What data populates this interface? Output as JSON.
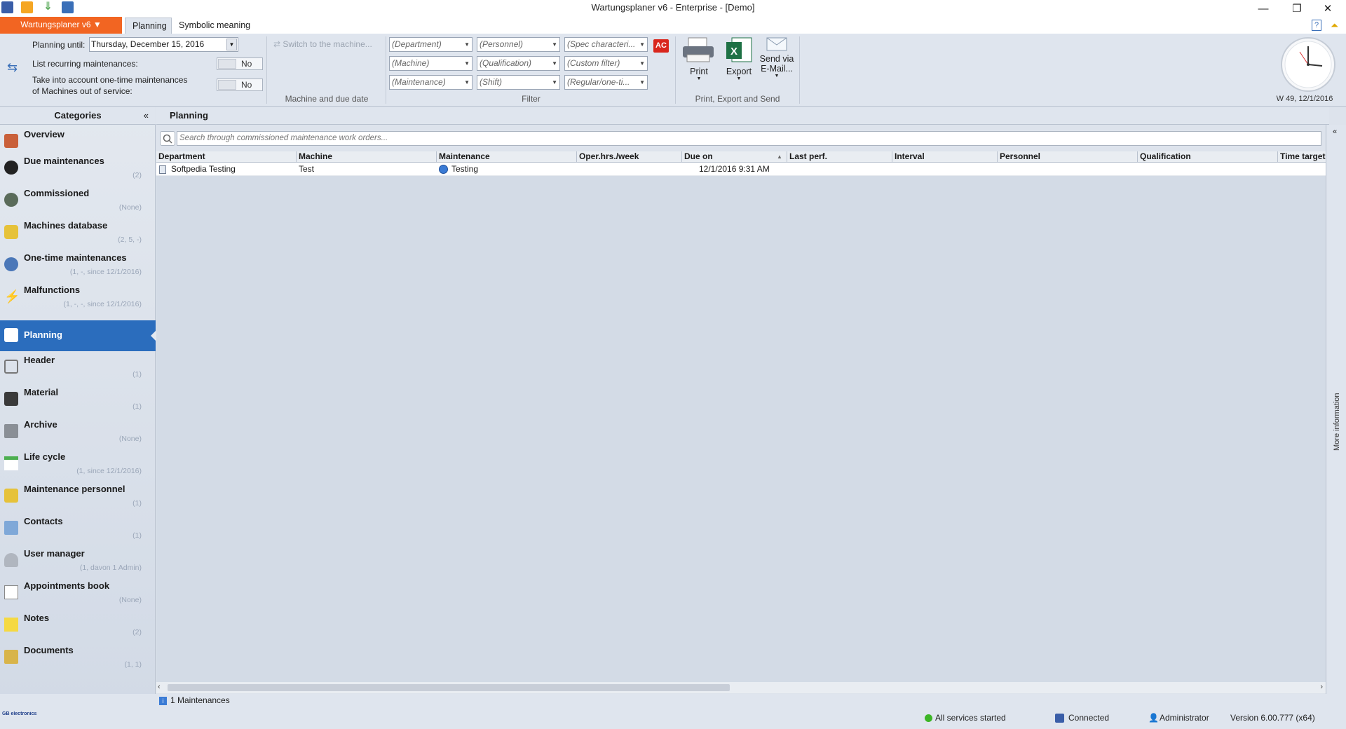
{
  "window": {
    "title": "Wartungsplaner v6 - Enterprise - [Demo]"
  },
  "ribbon_tabs": {
    "app_menu": "Wartungsplaner v6 ▼",
    "planning": "Planning",
    "symbolic": "Symbolic meaning"
  },
  "ribbon": {
    "planning_until_label": "Planning until:",
    "planning_until_value": "Thursday, December  15, 2016",
    "list_recurring_label": "List recurring maintenances:",
    "list_recurring_value": "No",
    "one_time_label_1": "Take into account one-time maintenances",
    "one_time_label_2": "of Machines out of service:",
    "one_time_value": "No",
    "switch_machine": "Switch to the machine...",
    "group_machine": "Machine and due date",
    "filters": {
      "department": "(Department)",
      "personnel": "(Personnel)",
      "spec": "(Spec characteri...",
      "machine": "(Machine)",
      "qualification": "(Qualification)",
      "custom": "(Custom filter)",
      "maintenance": "(Maintenance)",
      "shift": "(Shift)",
      "regular": "(Regular/one-ti..."
    },
    "ac_badge": "AC",
    "group_filter": "Filter",
    "print": "Print",
    "export": "Export",
    "send_1": "Send via",
    "send_2": "E-Mail...",
    "group_print": "Print, Export and Send",
    "week_date": "W 49, 12/1/2016"
  },
  "categories": {
    "header": "Categories",
    "collapse": "«",
    "items": [
      {
        "name": "Overview",
        "count": ""
      },
      {
        "name": "Due maintenances",
        "count": "(2)"
      },
      {
        "name": "Commissioned",
        "count": "(None)"
      },
      {
        "name": "Machines database",
        "count": "(2, 5, -)"
      },
      {
        "name": "One-time  maintenances",
        "count": "(1, -, since 12/1/2016)"
      },
      {
        "name": "Malfunctions",
        "count": "(1, -, -, since 12/1/2016)"
      },
      {
        "name": "Planning",
        "count": ""
      },
      {
        "name": "Header",
        "count": "(1)"
      },
      {
        "name": "Material",
        "count": "(1)"
      },
      {
        "name": "Archive",
        "count": "(None)"
      },
      {
        "name": "Life cycle",
        "count": "(1, since 12/1/2016)"
      },
      {
        "name": "Maintenance  personnel",
        "count": "(1)"
      },
      {
        "name": "Contacts",
        "count": "(1)"
      },
      {
        "name": "User manager",
        "count": "(1, davon 1 Admin)"
      },
      {
        "name": "Appointments  book",
        "count": "(None)"
      },
      {
        "name": "Notes",
        "count": "(2)"
      },
      {
        "name": "Documents",
        "count": "(1, 1)"
      }
    ]
  },
  "main": {
    "title": "Planning",
    "search_placeholder": "Search through commissioned maintenance work orders...",
    "columns": [
      "Department",
      "Machine",
      "Maintenance",
      "Oper.hrs./week",
      "Due on",
      "Last perf.",
      "Interval",
      "Personnel",
      "Qualification",
      "Time target"
    ],
    "rows": [
      {
        "department": "Softpedia Testing",
        "machine": "Test",
        "maintenance": "Testing",
        "oper": "",
        "due": "12/1/2016 9:31 AM",
        "last": "",
        "interval": "",
        "personnel": "",
        "qualification": "",
        "time": ""
      }
    ],
    "more_info": "More information"
  },
  "status": {
    "count": "1 Maintenances",
    "services": "All services started",
    "connected": "Connected",
    "user": "Administrator",
    "version": "Version 6.00.777 (x64)",
    "logo": "GB electronics"
  },
  "colors": {
    "accent": "#f26522",
    "selection": "#2b6dbd",
    "ok": "#3cb526"
  }
}
